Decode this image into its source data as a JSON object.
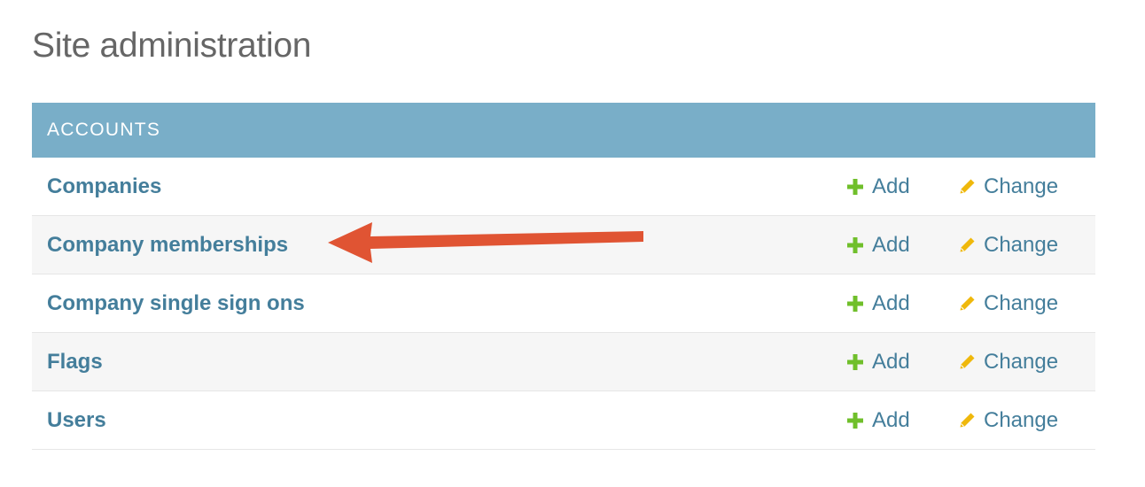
{
  "page": {
    "title": "Site administration"
  },
  "module": {
    "caption": "ACCOUNTS",
    "rows": [
      {
        "name": "Companies",
        "add_label": "Add",
        "change_label": "Change"
      },
      {
        "name": "Company memberships",
        "add_label": "Add",
        "change_label": "Change"
      },
      {
        "name": "Company single sign ons",
        "add_label": "Add",
        "change_label": "Change"
      },
      {
        "name": "Flags",
        "add_label": "Add",
        "change_label": "Change"
      },
      {
        "name": "Users",
        "add_label": "Add",
        "change_label": "Change"
      }
    ]
  },
  "icons": {
    "add": "plus-icon",
    "change": "pencil-icon",
    "annotation": "red-arrow-icon"
  },
  "colors": {
    "caption_background": "#79aec8",
    "link": "#447e9b",
    "add_icon": "#70bf2b",
    "change_icon": "#efb80b",
    "annotation_arrow": "#e05433",
    "title": "#666666"
  }
}
